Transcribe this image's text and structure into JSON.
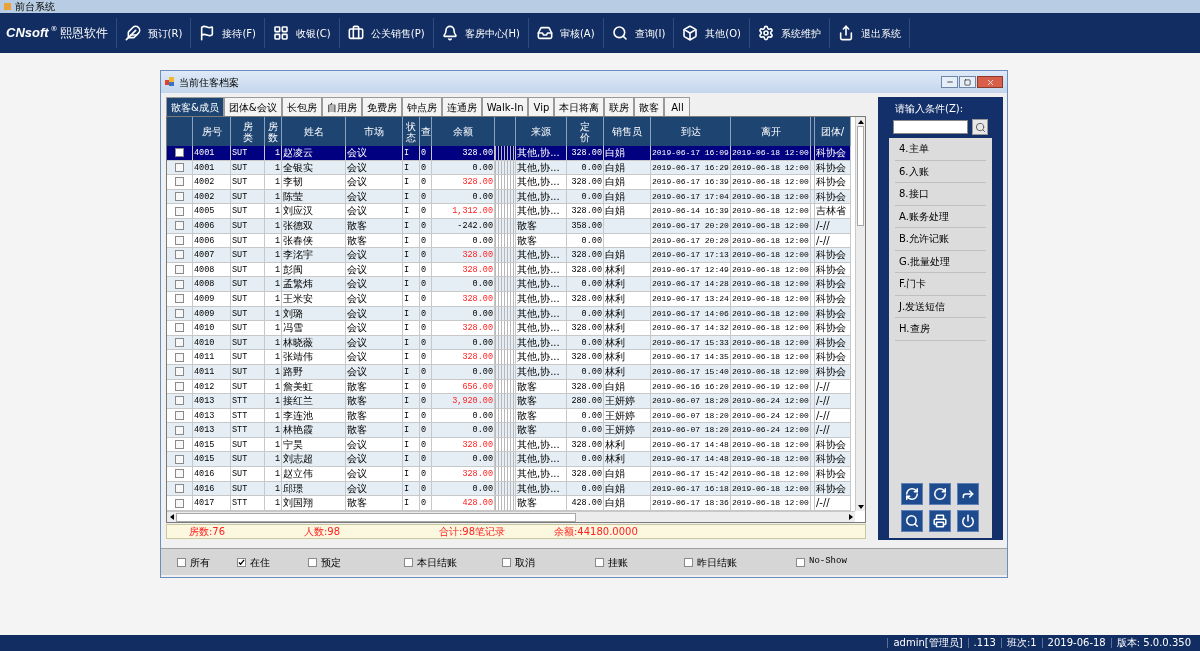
{
  "app_title": "前台系统",
  "logo": {
    "brand": "CNsoft",
    "mark": "®",
    "name": "熙恩软件"
  },
  "toolbar": [
    {
      "label": "预订(R)"
    },
    {
      "label": "接待(F)"
    },
    {
      "label": "收银(C)"
    },
    {
      "label": "公关销售(P)"
    },
    {
      "label": "客房中心(H)"
    },
    {
      "label": "审核(A)"
    },
    {
      "label": "查询(I)"
    },
    {
      "label": "其他(O)"
    },
    {
      "label": "系统维护"
    },
    {
      "label": "退出系统"
    }
  ],
  "window": {
    "title": "当前住客档案"
  },
  "tabs": [
    {
      "label": "散客&成员",
      "selected": true
    },
    {
      "label": "团体&会议",
      "selected": false
    },
    {
      "label": "长包房",
      "selected": false
    },
    {
      "label": "自用房",
      "selected": false
    },
    {
      "label": "免费房",
      "selected": false
    },
    {
      "label": "钟点房",
      "selected": false
    },
    {
      "label": "连通房",
      "selected": false
    },
    {
      "label": "Walk-In",
      "selected": false
    },
    {
      "label": "Vip",
      "selected": false
    },
    {
      "label": "本日将离",
      "selected": false
    },
    {
      "label": "联房",
      "selected": false
    },
    {
      "label": "散客",
      "selected": false
    },
    {
      "label": "All",
      "selected": false
    }
  ],
  "table": {
    "columns": {
      "room": "房号",
      "type": "房类",
      "count": "房数",
      "name": "姓名",
      "market": "市场",
      "status": "状态",
      "check": "查",
      "balance": "余额",
      "source": "来源",
      "price": "定价",
      "sales": "销售员",
      "arrive": "到达",
      "leave": "离开",
      "group": "团体/"
    },
    "rows": [
      {
        "selected": true,
        "checked": false,
        "room": "4001",
        "type": "SUT",
        "count": "1",
        "name": "赵凌云",
        "market": "会议",
        "status": "I",
        "check": "0",
        "balance": "328.00",
        "overdue": false,
        "source": "其他,协...",
        "price": "328.00",
        "sales": "白娟",
        "arrive": "2019-06-17 16:09",
        "leave": "2019-06-18 12:00",
        "group": "科协会"
      },
      {
        "selected": false,
        "checked": false,
        "room": "4001",
        "type": "SUT",
        "count": "1",
        "name": "全银实",
        "market": "会议",
        "status": "I",
        "check": "0",
        "balance": "0.00",
        "overdue": false,
        "source": "其他,协...",
        "price": "0.00",
        "sales": "白娟",
        "arrive": "2019-06-17 16:29",
        "leave": "2019-06-18 12:00",
        "group": "科协会"
      },
      {
        "selected": false,
        "checked": false,
        "room": "4002",
        "type": "SUT",
        "count": "1",
        "name": "李韧",
        "market": "会议",
        "status": "I",
        "check": "0",
        "balance": "328.00",
        "overdue": true,
        "source": "其他,协...",
        "price": "328.00",
        "sales": "白娟",
        "arrive": "2019-06-17 16:39",
        "leave": "2019-06-18 12:00",
        "group": "科协会"
      },
      {
        "selected": false,
        "checked": false,
        "room": "4002",
        "type": "SUT",
        "count": "1",
        "name": "陈莹",
        "market": "会议",
        "status": "I",
        "check": "0",
        "balance": "0.00",
        "overdue": false,
        "source": "其他,协...",
        "price": "0.00",
        "sales": "白娟",
        "arrive": "2019-06-17 17:04",
        "leave": "2019-06-18 12:00",
        "group": "科协会"
      },
      {
        "selected": false,
        "checked": false,
        "room": "4005",
        "type": "SUT",
        "count": "1",
        "name": "刘应汉",
        "market": "会议",
        "status": "I",
        "check": "0",
        "balance": "1,312.00",
        "overdue": true,
        "source": "其他,协...",
        "price": "328.00",
        "sales": "白娟",
        "arrive": "2019-06-14 16:39",
        "leave": "2019-06-18 12:00",
        "group": "吉林省"
      },
      {
        "selected": false,
        "checked": false,
        "room": "4006",
        "type": "SUT",
        "count": "1",
        "name": "张德双",
        "market": "散客",
        "status": "I",
        "check": "0",
        "balance": "-242.00",
        "overdue": false,
        "source": "散客",
        "price": "358.00",
        "arrive": "2019-06-17 20:20",
        "leave": "2019-06-18 12:00",
        "group": "/-//"
      },
      {
        "selected": false,
        "checked": false,
        "room": "4006",
        "type": "SUT",
        "count": "1",
        "name": "张春侠",
        "market": "散客",
        "status": "I",
        "check": "0",
        "balance": "0.00",
        "overdue": false,
        "source": "散客",
        "price": "0.00",
        "arrive": "2019-06-17 20:20",
        "leave": "2019-06-18 12:00",
        "group": "/-//"
      },
      {
        "selected": false,
        "checked": false,
        "room": "4007",
        "type": "SUT",
        "count": "1",
        "name": "李洺宇",
        "market": "会议",
        "status": "I",
        "check": "0",
        "balance": "328.00",
        "overdue": true,
        "source": "其他,协...",
        "price": "328.00",
        "sales": "白娟",
        "arrive": "2019-06-17 17:13",
        "leave": "2019-06-18 12:00",
        "group": "科协会"
      },
      {
        "selected": false,
        "checked": false,
        "room": "4008",
        "type": "SUT",
        "count": "1",
        "name": "彭闽",
        "market": "会议",
        "status": "I",
        "check": "0",
        "balance": "328.00",
        "overdue": true,
        "source": "其他,协...",
        "price": "328.00",
        "sales": "林利",
        "arrive": "2019-06-17 12:49",
        "leave": "2019-06-18 12:00",
        "group": "科协会"
      },
      {
        "selected": false,
        "checked": false,
        "room": "4008",
        "type": "SUT",
        "count": "1",
        "name": "孟繁炜",
        "market": "会议",
        "status": "I",
        "check": "0",
        "balance": "0.00",
        "overdue": false,
        "source": "其他,协...",
        "price": "0.00",
        "sales": "林利",
        "arrive": "2019-06-17 14:28",
        "leave": "2019-06-18 12:00",
        "group": "科协会"
      },
      {
        "selected": false,
        "checked": false,
        "room": "4009",
        "type": "SUT",
        "count": "1",
        "name": "王米安",
        "market": "会议",
        "status": "I",
        "check": "0",
        "balance": "328.00",
        "overdue": true,
        "source": "其他,协...",
        "price": "328.00",
        "sales": "林利",
        "arrive": "2019-06-17 13:24",
        "leave": "2019-06-18 12:00",
        "group": "科协会"
      },
      {
        "selected": false,
        "checked": false,
        "room": "4009",
        "type": "SUT",
        "count": "1",
        "name": "刘璐",
        "market": "会议",
        "status": "I",
        "check": "0",
        "balance": "0.00",
        "overdue": false,
        "source": "其他,协...",
        "price": "0.00",
        "sales": "林利",
        "arrive": "2019-06-17 14:06",
        "leave": "2019-06-18 12:00",
        "group": "科协会"
      },
      {
        "selected": false,
        "checked": false,
        "room": "4010",
        "type": "SUT",
        "count": "1",
        "name": "冯雪",
        "market": "会议",
        "status": "I",
        "check": "0",
        "balance": "328.00",
        "overdue": true,
        "source": "其他,协...",
        "price": "328.00",
        "sales": "林利",
        "arrive": "2019-06-17 14:32",
        "leave": "2019-06-18 12:00",
        "group": "科协会"
      },
      {
        "selected": false,
        "checked": false,
        "room": "4010",
        "type": "SUT",
        "count": "1",
        "name": "林晓薇",
        "market": "会议",
        "status": "I",
        "check": "0",
        "balance": "0.00",
        "overdue": false,
        "source": "其他,协...",
        "price": "0.00",
        "sales": "林利",
        "arrive": "2019-06-17 15:33",
        "leave": "2019-06-18 12:00",
        "group": "科协会"
      },
      {
        "selected": false,
        "checked": false,
        "room": "4011",
        "type": "SUT",
        "count": "1",
        "name": "张靖伟",
        "market": "会议",
        "status": "I",
        "check": "0",
        "balance": "328.00",
        "overdue": true,
        "source": "其他,协...",
        "price": "328.00",
        "sales": "林利",
        "arrive": "2019-06-17 14:35",
        "leave": "2019-06-18 12:00",
        "group": "科协会"
      },
      {
        "selected": false,
        "checked": false,
        "room": "4011",
        "type": "SUT",
        "count": "1",
        "name": "路野",
        "market": "会议",
        "status": "I",
        "check": "0",
        "balance": "0.00",
        "overdue": false,
        "source": "其他,协...",
        "price": "0.00",
        "sales": "林利",
        "arrive": "2019-06-17 15:40",
        "leave": "2019-06-18 12:00",
        "group": "科协会"
      },
      {
        "selected": false,
        "checked": false,
        "room": "4012",
        "type": "SUT",
        "count": "1",
        "name": "詹美虹",
        "market": "散客",
        "status": "I",
        "check": "0",
        "balance": "656.00",
        "overdue": true,
        "source": "散客",
        "price": "328.00",
        "sales": "白娟",
        "arrive": "2019-06-16 16:20",
        "leave": "2019-06-19 12:00",
        "group": "/-//"
      },
      {
        "selected": false,
        "checked": false,
        "room": "4013",
        "type": "STT",
        "count": "1",
        "name": "接红兰",
        "market": "散客",
        "status": "I",
        "check": "0",
        "balance": "3,920.00",
        "overdue": true,
        "source": "散客",
        "price": "280.00",
        "sales": "王妍婷",
        "arrive": "2019-06-07 18:20",
        "leave": "2019-06-24 12:00",
        "group": "/-//"
      },
      {
        "selected": false,
        "checked": false,
        "room": "4013",
        "type": "STT",
        "count": "1",
        "name": "李连池",
        "market": "散客",
        "status": "I",
        "check": "0",
        "balance": "0.00",
        "overdue": false,
        "source": "散客",
        "price": "0.00",
        "sales": "王妍婷",
        "arrive": "2019-06-07 18:20",
        "leave": "2019-06-24 12:00",
        "group": "/-//"
      },
      {
        "selected": false,
        "checked": false,
        "room": "4013",
        "type": "STT",
        "count": "1",
        "name": "林艳霞",
        "market": "散客",
        "status": "I",
        "check": "0",
        "balance": "0.00",
        "overdue": false,
        "source": "散客",
        "price": "0.00",
        "sales": "王妍婷",
        "arrive": "2019-06-07 18:20",
        "leave": "2019-06-24 12:00",
        "group": "/-//"
      },
      {
        "selected": false,
        "checked": false,
        "room": "4015",
        "type": "SUT",
        "count": "1",
        "name": "宁昊",
        "market": "会议",
        "status": "I",
        "check": "0",
        "balance": "328.00",
        "overdue": true,
        "source": "其他,协...",
        "price": "328.00",
        "sales": "林利",
        "arrive": "2019-06-17 14:48",
        "leave": "2019-06-18 12:00",
        "group": "科协会"
      },
      {
        "selected": false,
        "checked": false,
        "room": "4015",
        "type": "SUT",
        "count": "1",
        "name": "刘志超",
        "market": "会议",
        "status": "I",
        "check": "0",
        "balance": "0.00",
        "overdue": false,
        "source": "其他,协...",
        "price": "0.00",
        "sales": "林利",
        "arrive": "2019-06-17 14:48",
        "leave": "2019-06-18 12:00",
        "group": "科协会"
      },
      {
        "selected": false,
        "checked": false,
        "room": "4016",
        "type": "SUT",
        "count": "1",
        "name": "赵立伟",
        "market": "会议",
        "status": "I",
        "check": "0",
        "balance": "328.00",
        "overdue": true,
        "source": "其他,协...",
        "price": "328.00",
        "sales": "白娟",
        "arrive": "2019-06-17 15:42",
        "leave": "2019-06-18 12:00",
        "group": "科协会"
      },
      {
        "selected": false,
        "checked": false,
        "room": "4016",
        "type": "SUT",
        "count": "1",
        "name": "邱璟",
        "market": "会议",
        "status": "I",
        "check": "0",
        "balance": "0.00",
        "overdue": false,
        "source": "其他,协...",
        "price": "0.00",
        "sales": "白娟",
        "arrive": "2019-06-17 16:18",
        "leave": "2019-06-18 12:00",
        "group": "科协会"
      },
      {
        "selected": false,
        "checked": false,
        "room": "4017",
        "type": "STT",
        "count": "1",
        "name": "刘国翔",
        "market": "散客",
        "status": "I",
        "check": "0",
        "balance": "428.00",
        "overdue": true,
        "source": "散客",
        "price": "428.00",
        "sales": "白娟",
        "arrive": "2019-06-17 18:36",
        "leave": "2019-06-18 12:00",
        "group": "/-//"
      }
    ]
  },
  "summary": [
    {
      "text": "房数:76"
    },
    {
      "text": "人数:98"
    },
    {
      "text": "合计:98笔记录"
    },
    {
      "text": "余额:44180.0000"
    }
  ],
  "filters": [
    {
      "label": "所有",
      "checked": false
    },
    {
      "label": "在住",
      "checked": true
    },
    {
      "label": "预定",
      "checked": false
    },
    {
      "label": "本日结账",
      "checked": false
    },
    {
      "label": "取消",
      "checked": false
    },
    {
      "label": "挂账",
      "checked": false
    },
    {
      "label": "昨日结账",
      "checked": false
    },
    {
      "label": "No-Show",
      "checked": false
    }
  ],
  "side_panel": {
    "search_label": "请输入条件(Z):",
    "menu": [
      "4.主单",
      "6.入账",
      "8.接口",
      "A.账务处理",
      "B.允许记账",
      "G.批量处理",
      "F.门卡",
      "J.发送短信",
      "H.查房"
    ]
  },
  "status_bar": [
    "admin[管理员]",
    ".113",
    "班次:1",
    "2019-06-18",
    "版本: 5.0.0.350"
  ]
}
